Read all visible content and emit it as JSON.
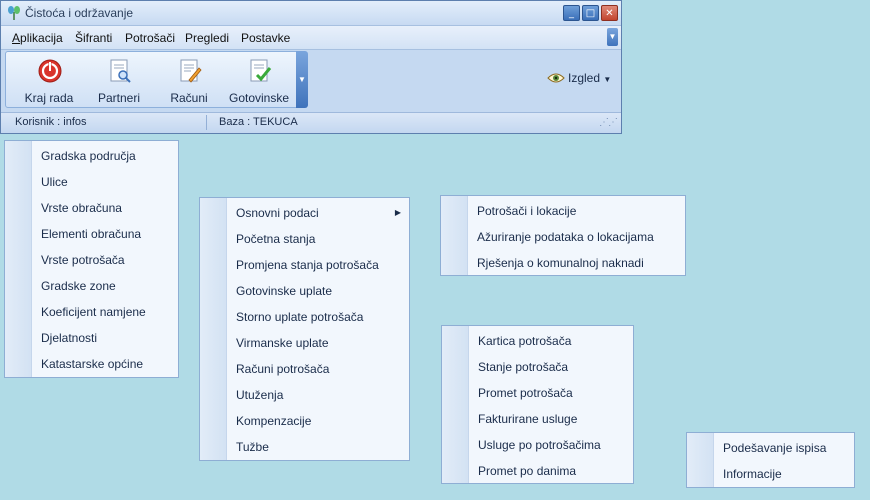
{
  "window": {
    "title": "Čistoća i održavanje",
    "buttons": {
      "minimize": "_",
      "maximize": "□",
      "close": "✕"
    }
  },
  "menubar": {
    "items": [
      "Aplikacija",
      "Šifranti",
      "Potrošači",
      "Pregledi",
      "Postavke"
    ]
  },
  "ribbon": {
    "buttons": [
      {
        "label": "Kraj rada",
        "icon": "power-icon"
      },
      {
        "label": "Partneri",
        "icon": "document-search-icon"
      },
      {
        "label": "Računi",
        "icon": "document-edit-icon"
      },
      {
        "label": "Gotovinske",
        "icon": "document-check-icon"
      }
    ],
    "view_label": "Izgled"
  },
  "statusbar": {
    "user": "Korisnik  :  infos",
    "db": "Baza  :  TEKUCA"
  },
  "menus": {
    "sifranti": [
      "Gradska područja",
      "Ulice",
      "Vrste obračuna",
      "Elementi obračuna",
      "Vrste potrošača",
      "Gradske zone",
      "Koeficijent namjene",
      "Djelatnosti",
      "Katastarske općine"
    ],
    "potrosaci": [
      "Osnovni podaci",
      "Početna stanja",
      "Promjena stanja potrošača",
      "Gotovinske uplate",
      "Storno uplate potrošača",
      "Virmanske uplate",
      "Računi potrošača",
      "Utuženja",
      "Kompenzacije",
      "Tužbe"
    ],
    "osnovni_podaci": [
      "Potrošači i lokacije",
      "Ažuriranje podataka o lokacijama",
      "Rješenja o komunalnoj naknadi"
    ],
    "pregledi": [
      "Kartica potrošača",
      "Stanje potrošača",
      "Promet potrošača",
      "Fakturirane usluge",
      "Usluge po potrošačima",
      "Promet po danima"
    ],
    "postavke": [
      "Podešavanje ispisa",
      "Informacije"
    ]
  }
}
